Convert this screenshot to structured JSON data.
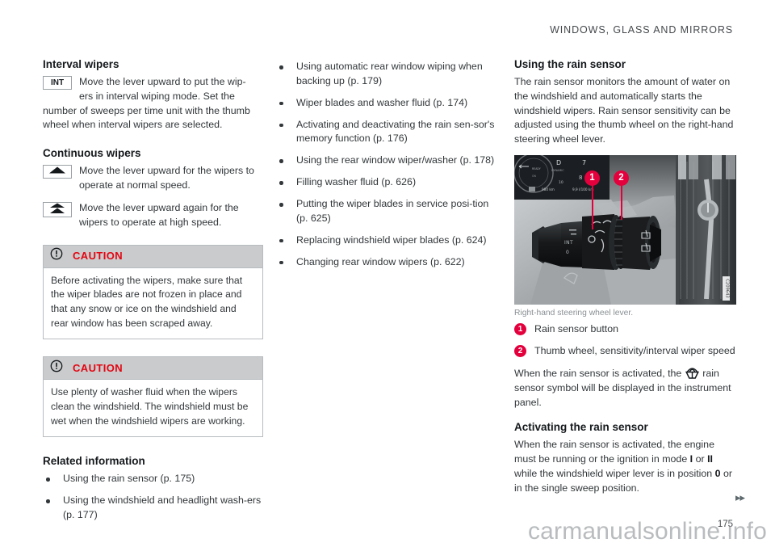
{
  "header": {
    "running_head": "WINDOWS, GLASS AND MIRRORS"
  },
  "column_left": {
    "interval": {
      "heading": "Interval wipers",
      "symbol_label": "INT",
      "text_indent": "Move the lever upward to put the wip-",
      "text_indent2": "ers in interval wiping mode. Set the",
      "text_rest": "number of sweeps per time unit with the thumb wheel when interval wipers are selected."
    },
    "continuous": {
      "heading": "Continuous wipers",
      "rows": [
        {
          "icon": "single-chevron-up-icon",
          "text": "Move the lever upward for the wipers to operate at normal speed."
        },
        {
          "icon": "double-chevron-up-icon",
          "text": "Move the lever upward again for the wipers to operate at high speed."
        }
      ]
    },
    "caution_1": {
      "icon": "exclamation-circle-icon",
      "title": "CAUTION",
      "body": "Before activating the wipers, make sure that the wiper blades are not frozen in place and that any snow or ice on the windshield and rear window has been scraped away."
    },
    "caution_2": {
      "icon": "exclamation-circle-icon",
      "title": "CAUTION",
      "body": "Use plenty of washer fluid when the wipers clean the windshield. The windshield must be wet when the windshield wipers are working."
    },
    "related": {
      "heading": "Related information",
      "items": [
        "Using the rain sensor (p. 175)",
        "Using the windshield and headlight wash-ers (p. 177)"
      ]
    }
  },
  "column_middle": {
    "items": [
      "Using automatic rear window wiping when backing up (p. 179)",
      "Wiper blades and washer fluid (p. 174)",
      "Activating and deactivating the rain sen-sor's memory function (p. 176)",
      "Using the rear window wiper/washer (p. 178)",
      "Filling washer fluid (p. 626)",
      "Putting the wiper blades in service posi-tion (p. 625)",
      "Replacing windshield wiper blades (p. 624)",
      "Changing rear window wipers (p. 622)"
    ]
  },
  "column_right": {
    "rain_sensor": {
      "heading": "Using the rain sensor",
      "body": "The rain sensor monitors the amount of water on the windshield and automatically starts the windshield wipers. Rain sensor sensitivity can be adjusted using the thumb wheel on the right-hand steering wheel lever."
    },
    "figure": {
      "caption": "Right-hand steering wheel lever.",
      "image_code": "C209643",
      "callouts": [
        {
          "number": "1"
        },
        {
          "number": "2"
        }
      ]
    },
    "legend": [
      {
        "number": "1",
        "text": "Rain sensor button"
      },
      {
        "number": "2",
        "text": "Thumb wheel, sensitivity/interval wiper speed"
      }
    ],
    "symbol_note": {
      "before": "When the rain sensor is activated, the",
      "icon": "rain-sensor-icon",
      "after": "rain sensor symbol will be displayed in the instrument panel."
    },
    "activating": {
      "heading": "Activating the rain sensor",
      "part1": "When the rain sensor is activated, the engine must be running or the ignition in mode",
      "mode1": "I",
      "conj": "or",
      "mode2": "II",
      "part2": "while the windshield wiper lever is in position",
      "mode3": "0",
      "part3": "or in the single sweep position."
    }
  },
  "footer": {
    "chevrons": "▸▸",
    "page_number": "175",
    "watermark": "carmanualsonline.info"
  },
  "colors": {
    "accent_red": "#e30613",
    "callout_pink": "#e4003c",
    "caution_header_bg": "#c9cbcc",
    "text": "#32373a"
  }
}
